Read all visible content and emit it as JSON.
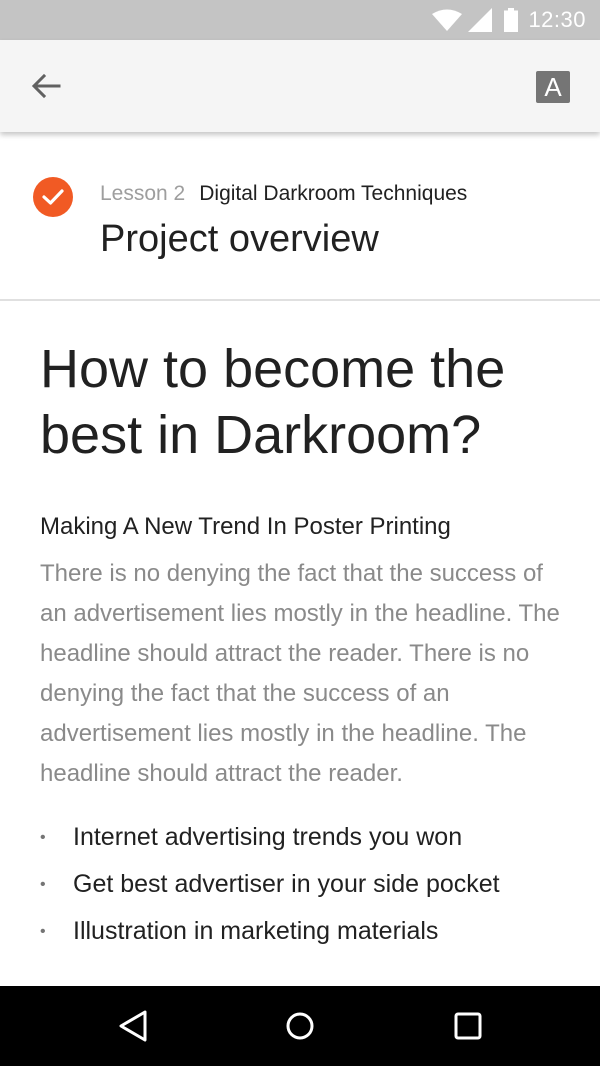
{
  "status_bar": {
    "time": "12:30",
    "icons": [
      "wifi-icon",
      "signal-icon",
      "battery-icon"
    ]
  },
  "app_bar": {
    "back_icon": "arrow-back-icon",
    "text_size_label": "A"
  },
  "lesson": {
    "number_label": "Lesson 2",
    "course_name": "Digital Darkroom Techniques",
    "title": "Project overview",
    "completed": true,
    "status_icon": "check-circle-icon"
  },
  "article": {
    "title": "How to become the best in Darkroom?",
    "subtitle": "Making A New Trend In Poster Printing",
    "body": "There is no denying the fact that the success of an advertisement lies mostly in the headline. The headline should attract the reader. There is no denying the fact that the success of an advertisement lies mostly in the headline. The headline should attract the reader.",
    "bullets": [
      "Internet advertising trends you won",
      "Get best advertiser in your side pocket",
      "Illustration in marketing materials"
    ]
  },
  "nav_bar": {
    "icons": [
      "nav-back-icon",
      "nav-home-icon",
      "nav-recents-icon"
    ]
  },
  "colors": {
    "accent": "#f15a24",
    "status_bar_bg": "#c4c4c4",
    "app_bar_bg": "#f5f5f5",
    "nav_bar_bg": "#000000",
    "body_text": "#8a8a8a",
    "primary_text": "#212121"
  }
}
